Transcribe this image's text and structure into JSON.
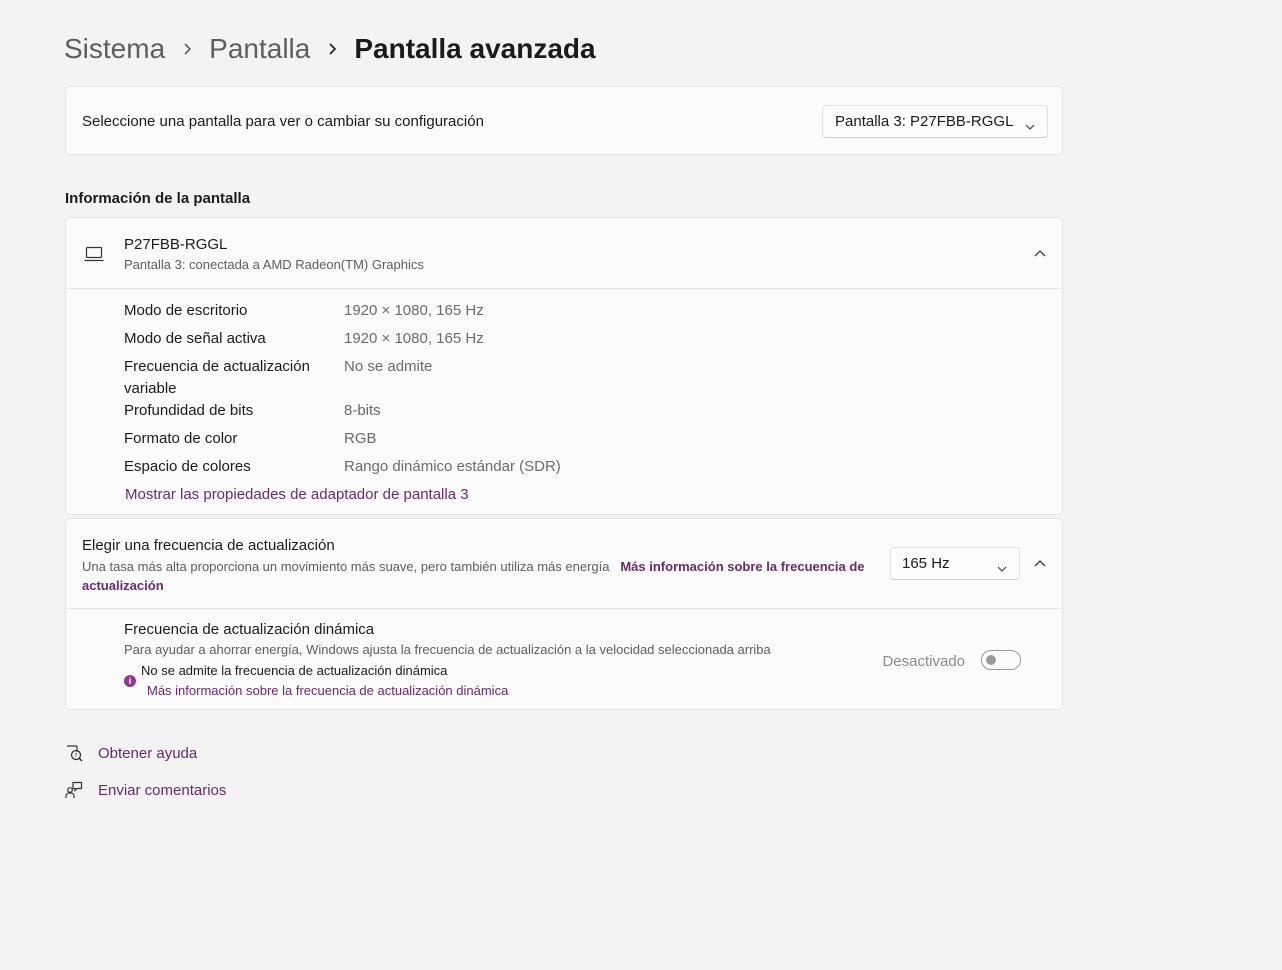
{
  "breadcrumb": {
    "items": [
      "Sistema",
      "Pantalla"
    ],
    "current": "Pantalla avanzada"
  },
  "display_select": {
    "label": "Seleccione una pantalla para ver o cambiar su configuración",
    "selected": "Pantalla 3: P27FBB-RGGL"
  },
  "info_section": {
    "title": "Información de la pantalla",
    "display_name": "P27FBB-RGGL",
    "display_subtitle": "Pantalla 3: conectada a AMD Radeon(TM) Graphics",
    "properties": [
      {
        "key": "Modo de escritorio",
        "value": "1920 × 1080, 165 Hz"
      },
      {
        "key": "Modo de señal activa",
        "value": "1920 × 1080, 165 Hz"
      },
      {
        "key": "Frecuencia de actualización variable",
        "value": "No se admite"
      },
      {
        "key": "Profundidad de bits",
        "value": "8-bits"
      },
      {
        "key": "Formato de color",
        "value": "RGB"
      },
      {
        "key": "Espacio de colores",
        "value": "Rango dinámico estándar (SDR)"
      }
    ],
    "adapter_link": "Mostrar las propiedades de adaptador de pantalla 3"
  },
  "refresh": {
    "title": "Elegir una frecuencia de actualización",
    "description": "Una tasa más alta proporciona un movimiento más suave, pero también utiliza más energía",
    "more_info_link": "Más información sobre la frecuencia de actualización",
    "selected_rate": "165 Hz",
    "dynamic": {
      "title": "Frecuencia de actualización dinámica",
      "description": "Para ayudar a ahorrar energía, Windows ajusta la frecuencia de actualización a la velocidad seleccionada arriba",
      "warning": "No se admite la frecuencia de actualización dinámica",
      "link": "Más información sobre la frecuencia de actualización dinámica",
      "toggle_label": "Desactivado",
      "toggle_on": false
    }
  },
  "footer_links": {
    "help": "Obtener ayuda",
    "feedback": "Enviar comentarios"
  },
  "colors": {
    "accent_link": "#6b2a6f",
    "background": "#f3f3f3",
    "card": "#fbfbfb"
  }
}
